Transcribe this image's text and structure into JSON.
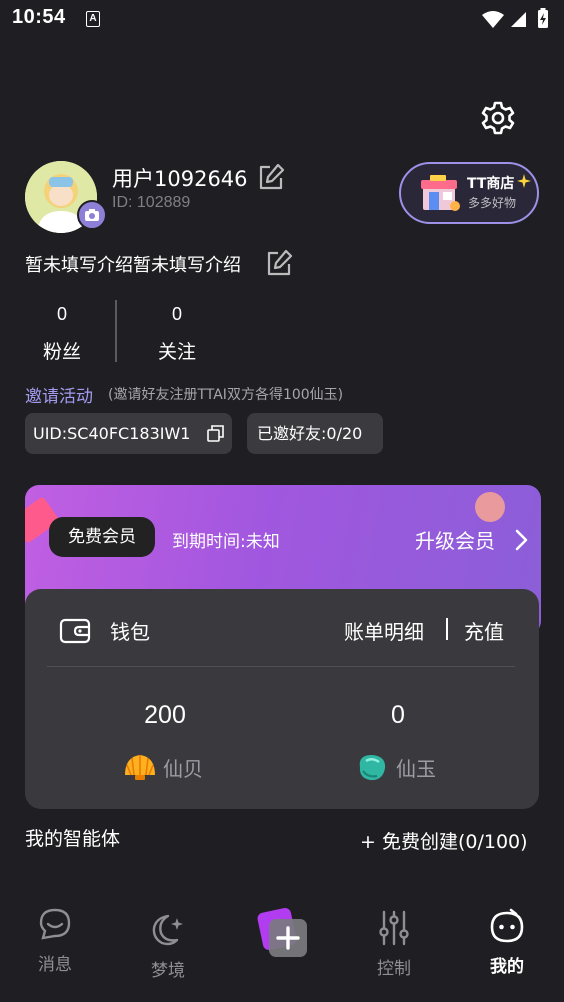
{
  "status_bar": {
    "time": "10:54",
    "indicator": "A"
  },
  "profile": {
    "username": "用户1092646",
    "user_id": "ID: 102889",
    "intro": "暂未填写介绍暂未填写介绍"
  },
  "shop": {
    "title": "TT商店",
    "subtitle": "多多好物"
  },
  "stats": {
    "fans": {
      "value": "0",
      "label": "粉丝"
    },
    "following": {
      "value": "0",
      "label": "关注"
    }
  },
  "invite": {
    "title": "邀请活动",
    "desc": "(邀请好友注册TTAI双方各得100仙玉)",
    "uid": "UID:SC40FC183IW1",
    "invited": "已邀好友:0/20"
  },
  "vip": {
    "badge": "免费会员",
    "expire": "到期时间:未知",
    "upgrade": "升级会员"
  },
  "wallet": {
    "title": "钱包",
    "bills": "账单明细",
    "recharge": "充值",
    "shells": {
      "value": "200",
      "label": "仙贝"
    },
    "jade": {
      "value": "0",
      "label": "仙玉"
    }
  },
  "agents": {
    "title": "我的智能体",
    "create": "+ 免费创建(0/100)"
  },
  "tabs": [
    {
      "label": "消息",
      "icon": "message-icon"
    },
    {
      "label": "梦境",
      "icon": "moon-icon"
    },
    {
      "label": "",
      "icon": "create-icon"
    },
    {
      "label": "控制",
      "icon": "sliders-icon"
    },
    {
      "label": "我的",
      "icon": "profile-icon",
      "active": true
    }
  ],
  "colors": {
    "background": "#1f1f23",
    "accent": "#a49bf0",
    "card": "#3a3a3e",
    "vip_gradient_start": "#c15fe2",
    "vip_gradient_end": "#8b5ed8"
  }
}
